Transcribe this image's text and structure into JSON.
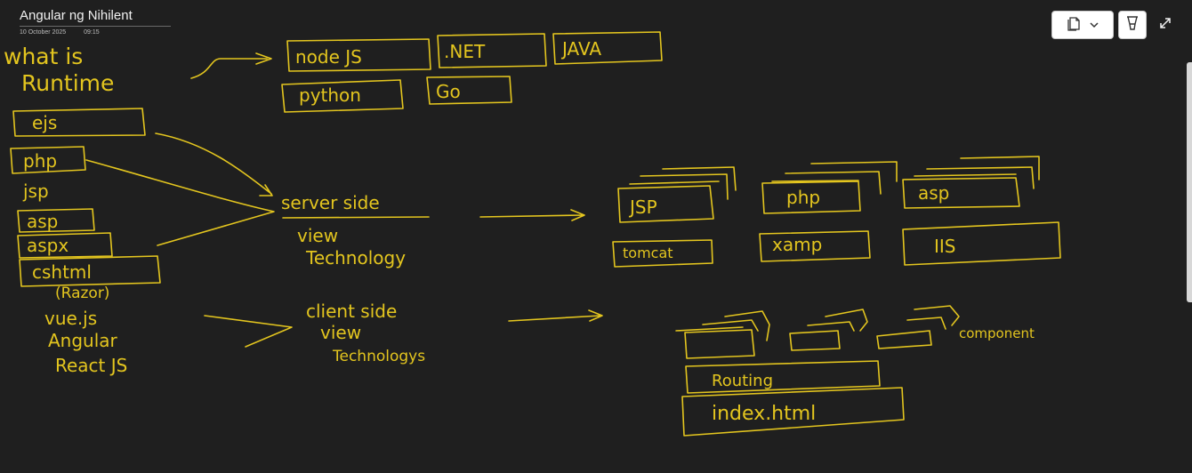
{
  "page": {
    "title": "Angular ng Nihilent",
    "date": "10 October 2025",
    "time": "09:15"
  },
  "toolbar": {
    "pages_icon": "pages-icon",
    "dropdown_icon": "chevron-down-icon",
    "pen_icon": "highlighter-pen-icon",
    "expand_icon": "expand-icon"
  },
  "ink": {
    "question": [
      "what is",
      "Runtime"
    ],
    "runtimes": [
      "node JS",
      ".NET",
      "JAVA",
      "python",
      "Go"
    ],
    "server_list": [
      "ejs",
      "php",
      "jsp",
      "asp",
      "aspx",
      "cshtml",
      "(Razor)"
    ],
    "server_side": [
      "server side",
      "view",
      "Technology"
    ],
    "server_boxes": [
      "JSP",
      "php",
      "asp"
    ],
    "servers": [
      "tomcat",
      "xamp",
      "IIS"
    ],
    "client_list": [
      "vue.js",
      "Angular",
      "React JS"
    ],
    "client_side": [
      "client side",
      "view",
      "Technologys"
    ],
    "component_label": "component",
    "routing": "Routing",
    "index": "index.html"
  }
}
